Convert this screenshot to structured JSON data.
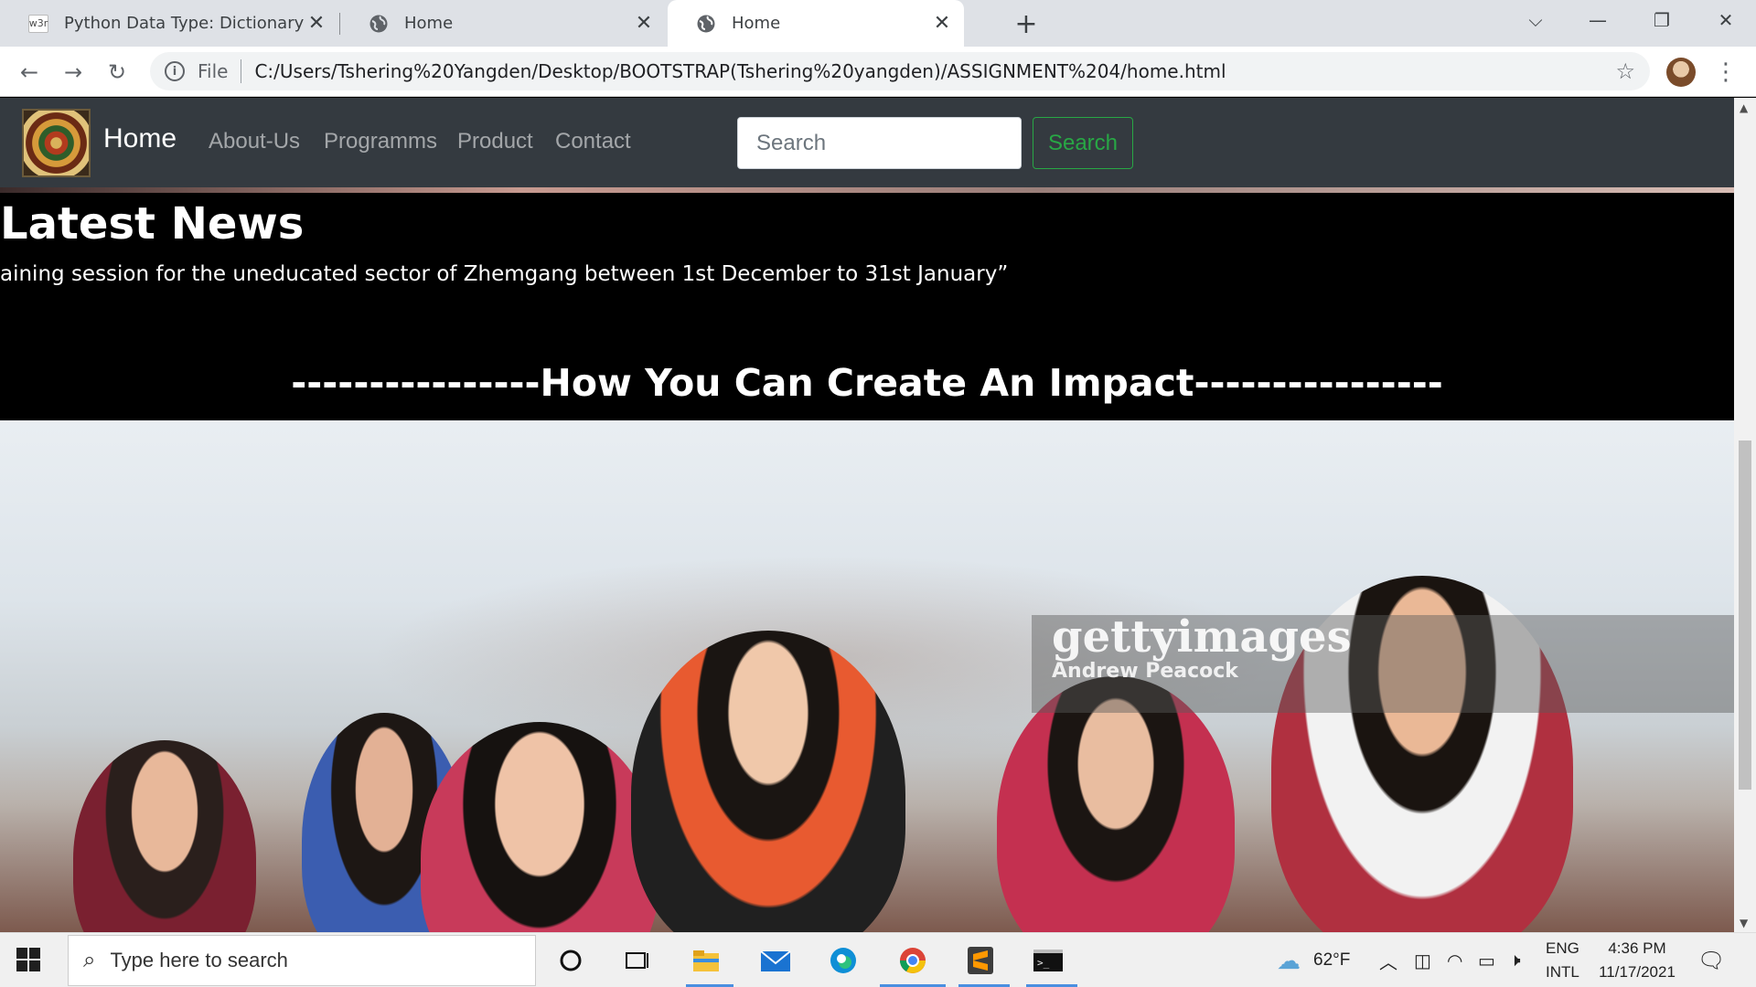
{
  "browser": {
    "tabs": [
      {
        "title": "Python Data Type: Dictionary - E",
        "favicon": "w3r"
      },
      {
        "title": "Home",
        "favicon": "globe-icon"
      },
      {
        "title": "Home",
        "favicon": "globe-icon"
      }
    ],
    "address": {
      "scheme_label": "File",
      "url": "C:/Users/Tshering%20Yangden/Desktop/BOOTSTRAP(Tshering%20yangden)/ASSIGNMENT%204/home.html"
    }
  },
  "site": {
    "brand": "Home",
    "nav": [
      "About-Us",
      "Programms",
      "Product",
      "Contact"
    ],
    "search_placeholder": "Search",
    "search_button": "Search",
    "latest_news_title": "Latest News",
    "news_marquee": "aining session for the uneducated sector of Zhemgang between 1st December to 31st January”",
    "impact_heading": "----------------How You Can Create An Impact----------------",
    "photo_watermark": "gettyimages",
    "photo_credit": "Andrew Peacock"
  },
  "taskbar": {
    "search_placeholder": "Type here to search",
    "weather": "62°F",
    "lang_top": "ENG",
    "lang_bottom": "INTL",
    "time": "4:36 PM",
    "date": "11/17/2021"
  }
}
